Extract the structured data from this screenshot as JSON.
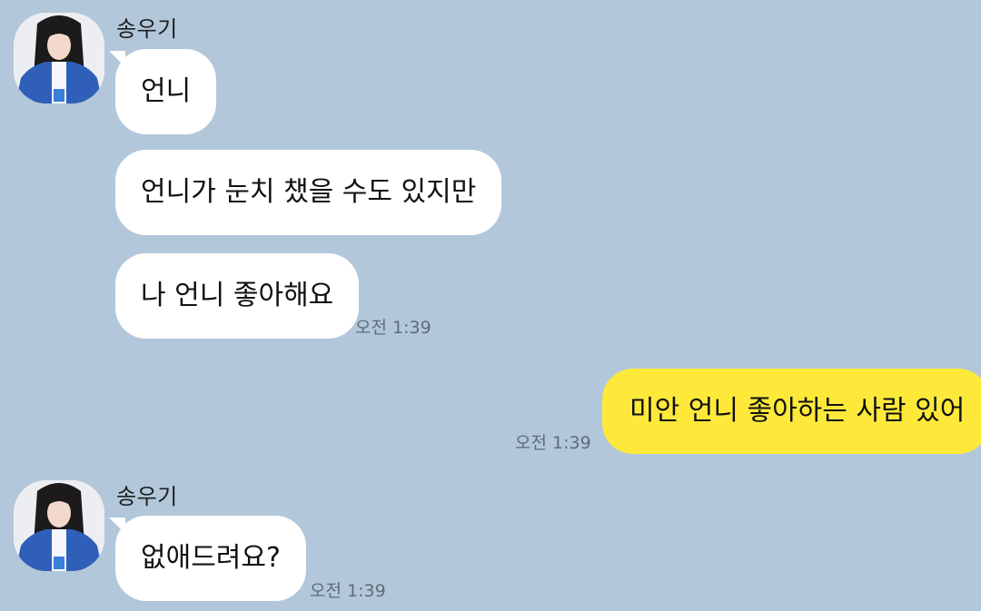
{
  "colors": {
    "chat_background": "#b2c7da",
    "incoming_bubble": "#ffffff",
    "outgoing_bubble": "#fee93b",
    "timestamp_text": "#5f6b78"
  },
  "messages": [
    {
      "sender": "송우기",
      "direction": "incoming",
      "texts": [
        "언니",
        "언니가 눈치 챘을 수도 있지만",
        "나 언니 좋아해요"
      ],
      "time": "오전 1:39"
    },
    {
      "direction": "outgoing",
      "texts": [
        "미안 언니 좋아하는 사람 있어"
      ],
      "time": "오전 1:39"
    },
    {
      "sender": "송우기",
      "direction": "incoming",
      "texts": [
        "없애드려요?"
      ],
      "time": "오전 1:39"
    }
  ]
}
